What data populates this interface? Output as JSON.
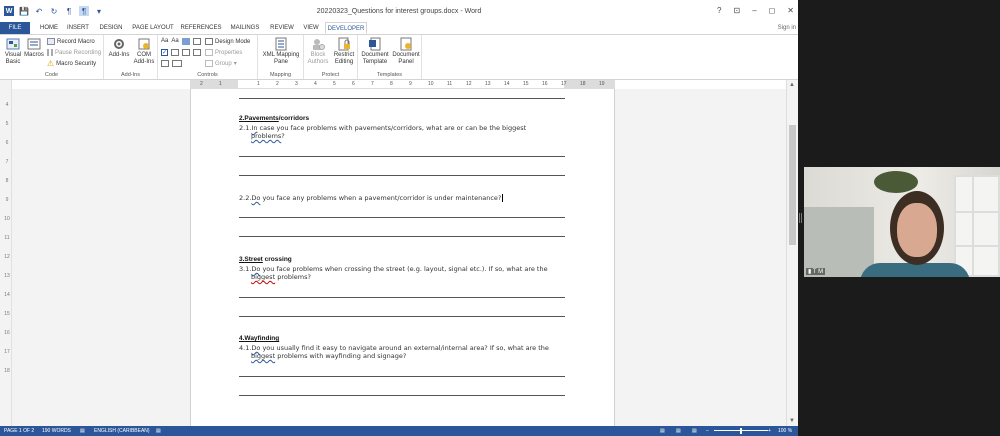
{
  "window": {
    "title": "20220323_Questions for interest groups.docx - Word",
    "controls": [
      "?",
      "⊡",
      "–",
      "◻",
      "✕"
    ]
  },
  "tabs": [
    {
      "label": "FILE"
    },
    {
      "label": "HOME"
    },
    {
      "label": "INSERT"
    },
    {
      "label": "DESIGN"
    },
    {
      "label": "PAGE LAYOUT"
    },
    {
      "label": "REFERENCES"
    },
    {
      "label": "MAILINGS"
    },
    {
      "label": "REVIEW"
    },
    {
      "label": "VIEW"
    },
    {
      "label": "DEVELOPER"
    }
  ],
  "signin": "Sign in",
  "ribbon": {
    "code": {
      "name": "Code",
      "visual_basic": "Visual Basic",
      "macros": "Macros",
      "record_macro": "Record Macro",
      "pause_recording": "Pause Recording",
      "macro_security": "Macro Security"
    },
    "addins": {
      "name": "Add-Ins",
      "addins": "Add-Ins",
      "com_addins": "COM Add-Ins"
    },
    "controls": {
      "name": "Controls",
      "design_mode": "Design Mode",
      "properties": "Properties",
      "group": "Group"
    },
    "mapping": {
      "name": "Mapping",
      "xml_pane": "XML Mapping Pane"
    },
    "protect": {
      "name": "Protect",
      "block_authors": "Block Authors",
      "restrict_editing": "Restrict Editing"
    },
    "templates": {
      "name": "Templates",
      "doc_template": "Document Template",
      "doc_panel": "Document Panel"
    }
  },
  "ruler": {
    "labels": [
      "2",
      "1",
      "1",
      "2",
      "3",
      "4",
      "5",
      "6",
      "7",
      "8",
      "9",
      "10",
      "11",
      "12",
      "13",
      "14",
      "15",
      "16",
      "17",
      "18",
      "19"
    ],
    "vlabels": [
      "4",
      "5",
      "6",
      "7",
      "8",
      "9",
      "10",
      "11",
      "12",
      "13",
      "14",
      "15",
      "16",
      "17",
      "18"
    ]
  },
  "document": {
    "s2_heading_num": "2.",
    "s2_heading_word": "Pavements",
    "s2_heading_rest": "/corridors",
    "q21_pre": "2.1.",
    "q21_sp": "In",
    "q21_text": " case you face problems with pavements/corridors, what are or can be the biggest",
    "q21_sp2": "problems",
    "q21_end": "?",
    "q22_pre": "2.2.",
    "q22_sp": "Do",
    "q22_text": " you face any problems when a pavement/corridor is under maintenance?",
    "s3_heading_num": "3.",
    "s3_heading_word": "Street",
    "s3_heading_rest": " crossing",
    "q31_pre": "3.1.",
    "q31_sp": "Do",
    "q31_text": " you face problems when crossing the street (e.g. layout, signal etc.). If so, what are the",
    "q31_sp2": "biggest",
    "q31_end": " problems?",
    "s4_heading_num": "4.",
    "s4_heading_word": "Wayfinding",
    "q41_pre": "4.1.",
    "q41_sp": "Do",
    "q41_text": " you usually find it easy to navigate around an external/internal area? If so, what are the",
    "q41_sp2": "biggest",
    "q41_end": " problems with wayfinding and signage?"
  },
  "statusbar": {
    "page": "PAGE 1 OF 2",
    "words": "190 WORDS",
    "language": "ENGLISH (CARIBBEAN)",
    "zoom": "100 %",
    "zoom_level": 1.0
  },
  "video": {
    "participant": "T M"
  },
  "colors": {
    "word_blue": "#2b579a",
    "status_bg": "#2b579a"
  }
}
